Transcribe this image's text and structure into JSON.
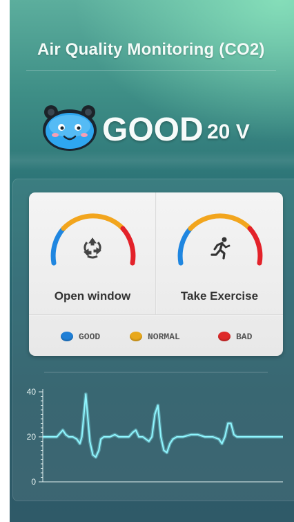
{
  "header": {
    "title": "Air Quality Monitoring (CO2)"
  },
  "status": {
    "label": "GOOD",
    "value": "20 V",
    "mascot": "smiling-blue-face-icon"
  },
  "actions": [
    {
      "label": "Open window",
      "icon": "recycle-arrows-icon"
    },
    {
      "label": "Take Exercise",
      "icon": "running-person-icon"
    }
  ],
  "legend": [
    {
      "label": "GOOD",
      "color": "#1f7fd6"
    },
    {
      "label": "NORMAL",
      "color": "#e8a81c"
    },
    {
      "label": "BAD",
      "color": "#de2a2a"
    }
  ],
  "gauge_colors": {
    "good": "#1f86e0",
    "normal": "#f2a51d",
    "bad": "#e3222a"
  },
  "chart_data": {
    "type": "line",
    "ylim": [
      0,
      40
    ],
    "yticks": [
      "40",
      "20",
      "0"
    ],
    "series": [
      {
        "color": "#8ff6ff",
        "points": [
          [
            0,
            20
          ],
          [
            14,
            20
          ],
          [
            18,
            22
          ],
          [
            20,
            23
          ],
          [
            23,
            21
          ],
          [
            26,
            20
          ],
          [
            30,
            20
          ],
          [
            34,
            19
          ],
          [
            37,
            17
          ],
          [
            39,
            20
          ],
          [
            43,
            39
          ],
          [
            47,
            18
          ],
          [
            50,
            12
          ],
          [
            53,
            11
          ],
          [
            56,
            14
          ],
          [
            58,
            19
          ],
          [
            61,
            20
          ],
          [
            67,
            20
          ],
          [
            72,
            21
          ],
          [
            76,
            20
          ],
          [
            80,
            20
          ],
          [
            86,
            20
          ],
          [
            90,
            22
          ],
          [
            93,
            23
          ],
          [
            96,
            20
          ],
          [
            100,
            20
          ],
          [
            106,
            18
          ],
          [
            109,
            20
          ],
          [
            112,
            30
          ],
          [
            115,
            34
          ],
          [
            118,
            20
          ],
          [
            121,
            14
          ],
          [
            124,
            13
          ],
          [
            127,
            17
          ],
          [
            130,
            19
          ],
          [
            134,
            20
          ],
          [
            140,
            20
          ],
          [
            148,
            21
          ],
          [
            155,
            21
          ],
          [
            162,
            20
          ],
          [
            170,
            20
          ],
          [
            176,
            19
          ],
          [
            179,
            17
          ],
          [
            182,
            20
          ],
          [
            185,
            26
          ],
          [
            188,
            26
          ],
          [
            191,
            21
          ],
          [
            194,
            20
          ],
          [
            200,
            20
          ],
          [
            240,
            20
          ]
        ]
      }
    ]
  }
}
